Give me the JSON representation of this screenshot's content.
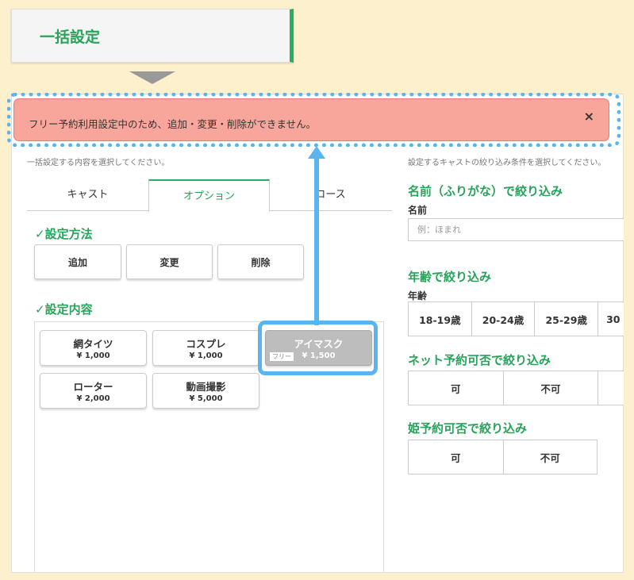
{
  "header": {
    "title": "一括設定"
  },
  "alert": {
    "message": "フリー予約利用設定中のため、追加・変更・削除ができません。",
    "close_label": "×"
  },
  "left": {
    "hint": "一括設定する内容を選択してください。",
    "tabs": [
      "キャスト",
      "オプション",
      "コース"
    ],
    "active_tab": "オプション",
    "method_title": "✓設定方法",
    "method_buttons": [
      "追加",
      "変更",
      "削除"
    ],
    "content_title": "✓設定内容",
    "options": [
      {
        "name": "網タイツ",
        "price": "¥ 1,000"
      },
      {
        "name": "コスプレ",
        "price": "¥ 1,000"
      },
      {
        "name": "アイマスク",
        "price": "¥ 1,500",
        "tag": "フリー",
        "disabled": true
      },
      {
        "name": "ローター",
        "price": "¥ 2,000"
      },
      {
        "name": "動画撮影",
        "price": "¥ 5,000"
      }
    ]
  },
  "right": {
    "hint": "設定するキャストの絞り込み条件を選択してください。",
    "name_filter": {
      "title": "名前（ふりがな）で絞り込み",
      "label": "名前",
      "placeholder": "例：ほまれ"
    },
    "age_filter": {
      "title": "年齢で絞り込み",
      "label": "年齢",
      "options": [
        "18-19歳",
        "20-24歳",
        "25-29歳",
        "30"
      ]
    },
    "net_filter": {
      "title": "ネット予約可否で絞り込み",
      "options": [
        "可",
        "不可",
        ""
      ]
    },
    "hime_filter": {
      "title": "姫予約可否で絞り込み",
      "options": [
        "可",
        "不可"
      ]
    }
  },
  "colors": {
    "accent": "#27a35a",
    "alert_bg": "#f8a59c",
    "highlight": "#5ab4ef",
    "page_bg": "#fdf0cc"
  }
}
